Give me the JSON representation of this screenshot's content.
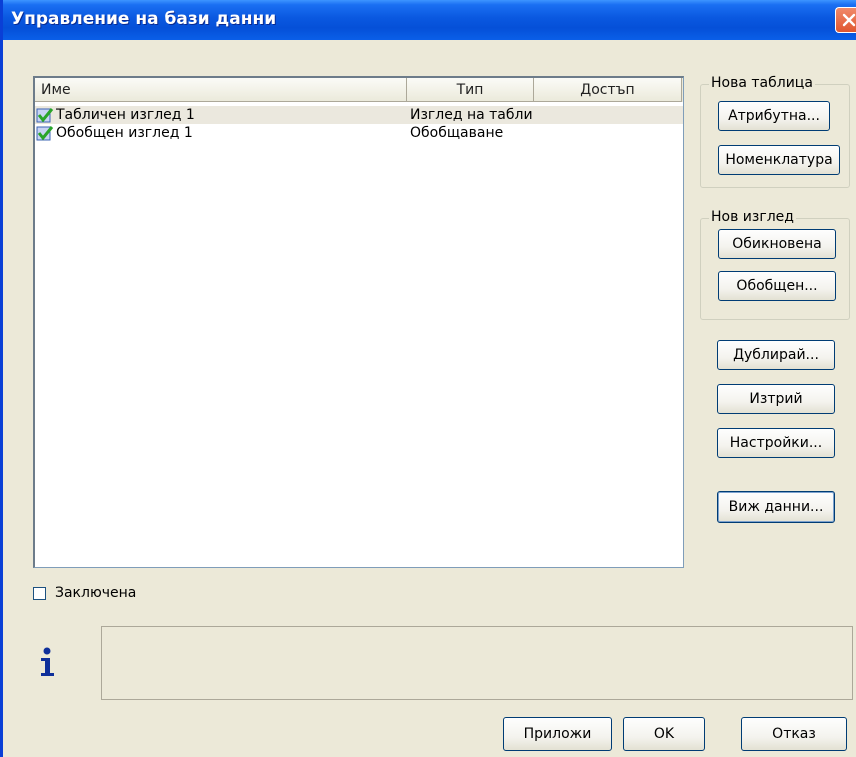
{
  "window": {
    "title": "Управление на бази данни"
  },
  "list": {
    "columns": [
      "Име",
      "Тип",
      "Достъп"
    ],
    "rows": [
      {
        "name": "Табличен изглед 1",
        "type": "Изглед на табли",
        "access": ""
      },
      {
        "name": "Обобщен изглед 1",
        "type": "Обобщаване",
        "access": ""
      }
    ]
  },
  "new_table": {
    "title": "Нова таблица",
    "attribute_btn": "Атрибутна...",
    "nomenclature_btn": "Номенклатура"
  },
  "new_view": {
    "title": "Нов изглед",
    "ordinary_btn": "Обикновена",
    "summary_btn": "Обобщен..."
  },
  "actions": {
    "duplicate": "Дублирай...",
    "delete": "Изтрий",
    "settings": "Настройки...",
    "view_data": "Виж данни..."
  },
  "locked": {
    "label": "Заключена",
    "checked": false
  },
  "footer": {
    "apply": "Приложи",
    "ok": "OK",
    "cancel": "Отказ"
  },
  "colors": {
    "title_bar": "#0a58e0",
    "dialog_bg": "#ece9d8"
  }
}
